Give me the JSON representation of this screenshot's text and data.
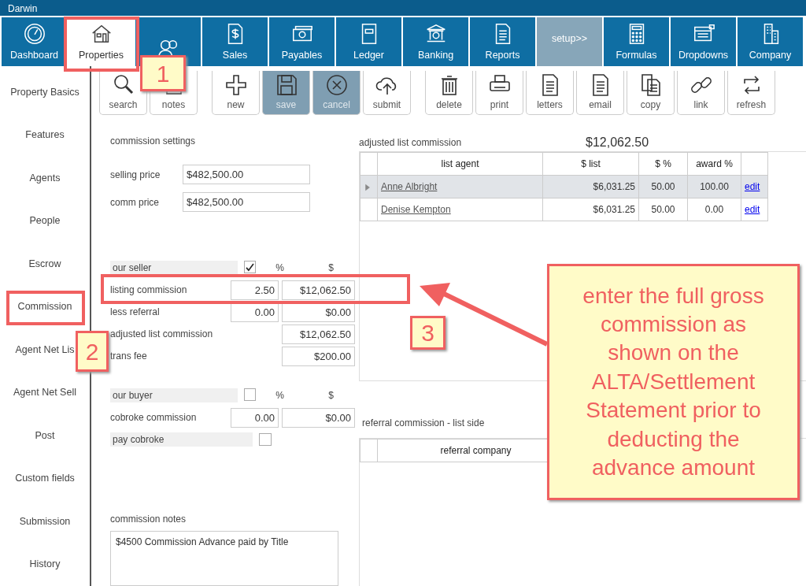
{
  "window": {
    "title": "Darwin"
  },
  "tabs": [
    {
      "label": "Dashboard",
      "selected": false
    },
    {
      "label": "Properties",
      "selected": true
    },
    {
      "selected": false
    },
    {
      "label": "Sales",
      "selected": false
    },
    {
      "label": "Payables",
      "selected": false
    },
    {
      "label": "Ledger",
      "selected": false
    },
    {
      "label": "Banking",
      "selected": false
    },
    {
      "label": "Reports",
      "selected": false
    },
    {
      "label": "setup>>",
      "selected": false,
      "kind": "text"
    },
    {
      "label": "Formulas",
      "selected": false
    },
    {
      "label": "Dropdowns",
      "selected": false
    },
    {
      "label": "Company",
      "selected": false
    }
  ],
  "sidebar": {
    "items": [
      {
        "label": "Property Basics"
      },
      {
        "label": "Features"
      },
      {
        "label": "Agents"
      },
      {
        "label": "People"
      },
      {
        "label": "Escrow"
      },
      {
        "label": "Commission"
      },
      {
        "label": "Agent Net Lis"
      },
      {
        "label": "Agent Net Sell"
      },
      {
        "label": "Post"
      },
      {
        "label": "Custom fields"
      },
      {
        "label": "Submission"
      },
      {
        "label": "History"
      }
    ]
  },
  "toolbar": [
    [
      {
        "label": "search",
        "highlighted": false
      },
      {
        "label": "notes",
        "highlighted": false
      }
    ],
    [
      {
        "label": "new",
        "highlighted": false
      },
      {
        "label": "save",
        "highlighted": true
      },
      {
        "label": "cancel",
        "highlighted": true
      },
      {
        "label": "submit",
        "highlighted": false
      }
    ],
    [
      {
        "label": "delete",
        "highlighted": false
      },
      {
        "label": "print",
        "highlighted": false
      },
      {
        "label": "letters",
        "highlighted": false
      },
      {
        "label": "email",
        "highlighted": false
      },
      {
        "label": "copy",
        "highlighted": false
      },
      {
        "label": "link",
        "highlighted": false
      },
      {
        "label": "refresh",
        "highlighted": false
      }
    ]
  ],
  "commission_settings": {
    "title": "commission settings",
    "prices": [
      {
        "label": "selling price",
        "value": "$482,500.00"
      },
      {
        "label": "comm price",
        "value": "$482,500.00"
      }
    ],
    "seller": {
      "label": "our seller",
      "checked": true,
      "pct_header": "%",
      "amount_header": "$",
      "rows": [
        {
          "label": "listing commission",
          "pct": "2.50",
          "amount": "$12,062.50"
        },
        {
          "label": "less referral",
          "pct": "0.00",
          "amount": "$0.00"
        },
        {
          "label": "adjusted list commission",
          "amount": "$12,062.50"
        },
        {
          "label": "trans fee",
          "amount": "$200.00"
        }
      ]
    },
    "buyer": {
      "label": "our buyer",
      "checked": false,
      "pct_header": "%",
      "amount_header": "$",
      "rows": [
        {
          "label": "cobroke commission",
          "pct": "0.00",
          "amount": "$0.00"
        }
      ],
      "pay_cobroke": {
        "label": "pay cobroke",
        "checked": false
      }
    },
    "notes": {
      "label": "commission notes",
      "value": "$4500 Commission Advance paid by Title"
    }
  },
  "adjusted_list_commission": {
    "title": "adjusted list commission",
    "total": "$12,062.50",
    "table": {
      "columns": [
        "list agent",
        "$ list",
        "$ %",
        "award %"
      ],
      "rows": [
        {
          "agent": "Anne Albright",
          "list": "$6,031.25",
          "pct": "50.00",
          "award": "100.00",
          "action": "edit",
          "selected": true
        },
        {
          "agent": "Denise Kempton",
          "list": "$6,031.25",
          "pct": "50.00",
          "award": "0.00",
          "action": "edit",
          "selected": false
        }
      ]
    }
  },
  "referral_commission": {
    "title": "referral commission - list side",
    "table": {
      "columns": [
        "referral company"
      ]
    }
  },
  "annotations": {
    "callouts": [
      {
        "number": "1"
      },
      {
        "number": "2"
      },
      {
        "number": "3"
      }
    ],
    "note": "enter the full gross commission as shown on the ALTA/Settlement Statement prior to deducting the advance amount"
  }
}
